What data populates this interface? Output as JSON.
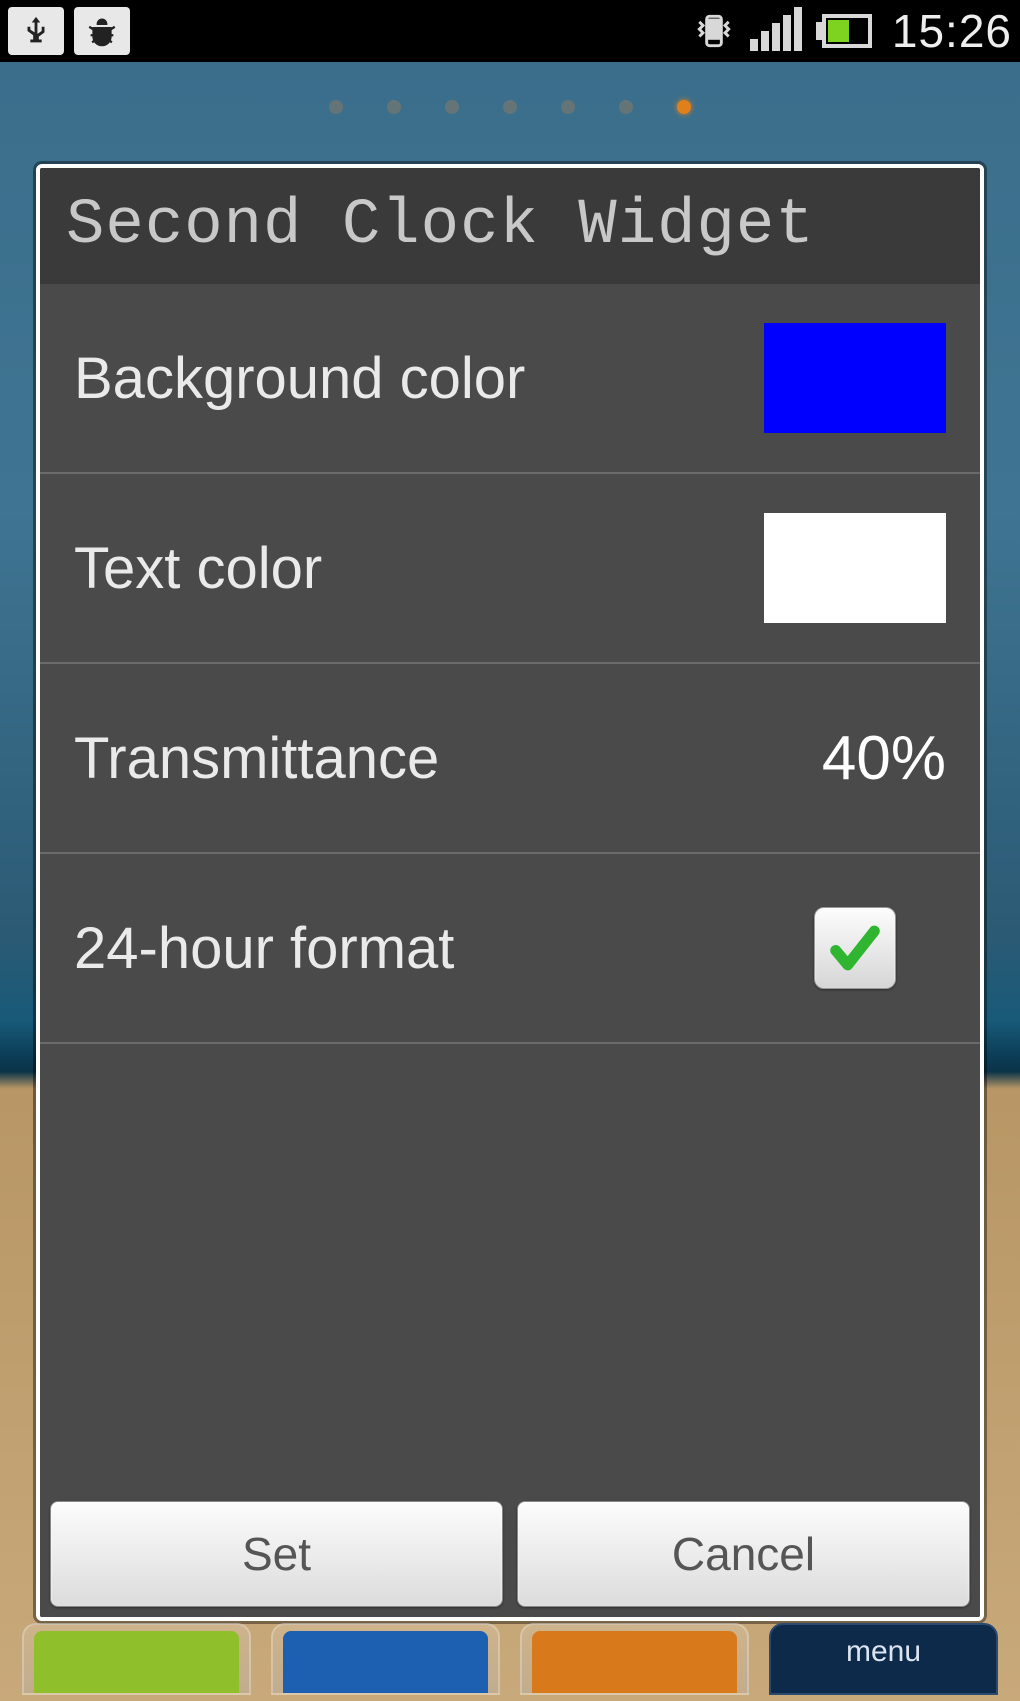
{
  "status_bar": {
    "time": "15:26"
  },
  "dialog": {
    "title": "Second Clock Widget",
    "rows": {
      "background_color": {
        "label": "Background color",
        "color": "#0000FF"
      },
      "text_color": {
        "label": "Text color",
        "color": "#FFFFFF"
      },
      "transmittance": {
        "label": "Transmittance",
        "value": "40%"
      },
      "hour_format": {
        "label": "24-hour format",
        "checked": true
      }
    },
    "buttons": {
      "set": "Set",
      "cancel": "Cancel"
    }
  },
  "dock": {
    "menu_label": "menu"
  },
  "page_indicator": {
    "count": 7,
    "active_index": 6
  }
}
